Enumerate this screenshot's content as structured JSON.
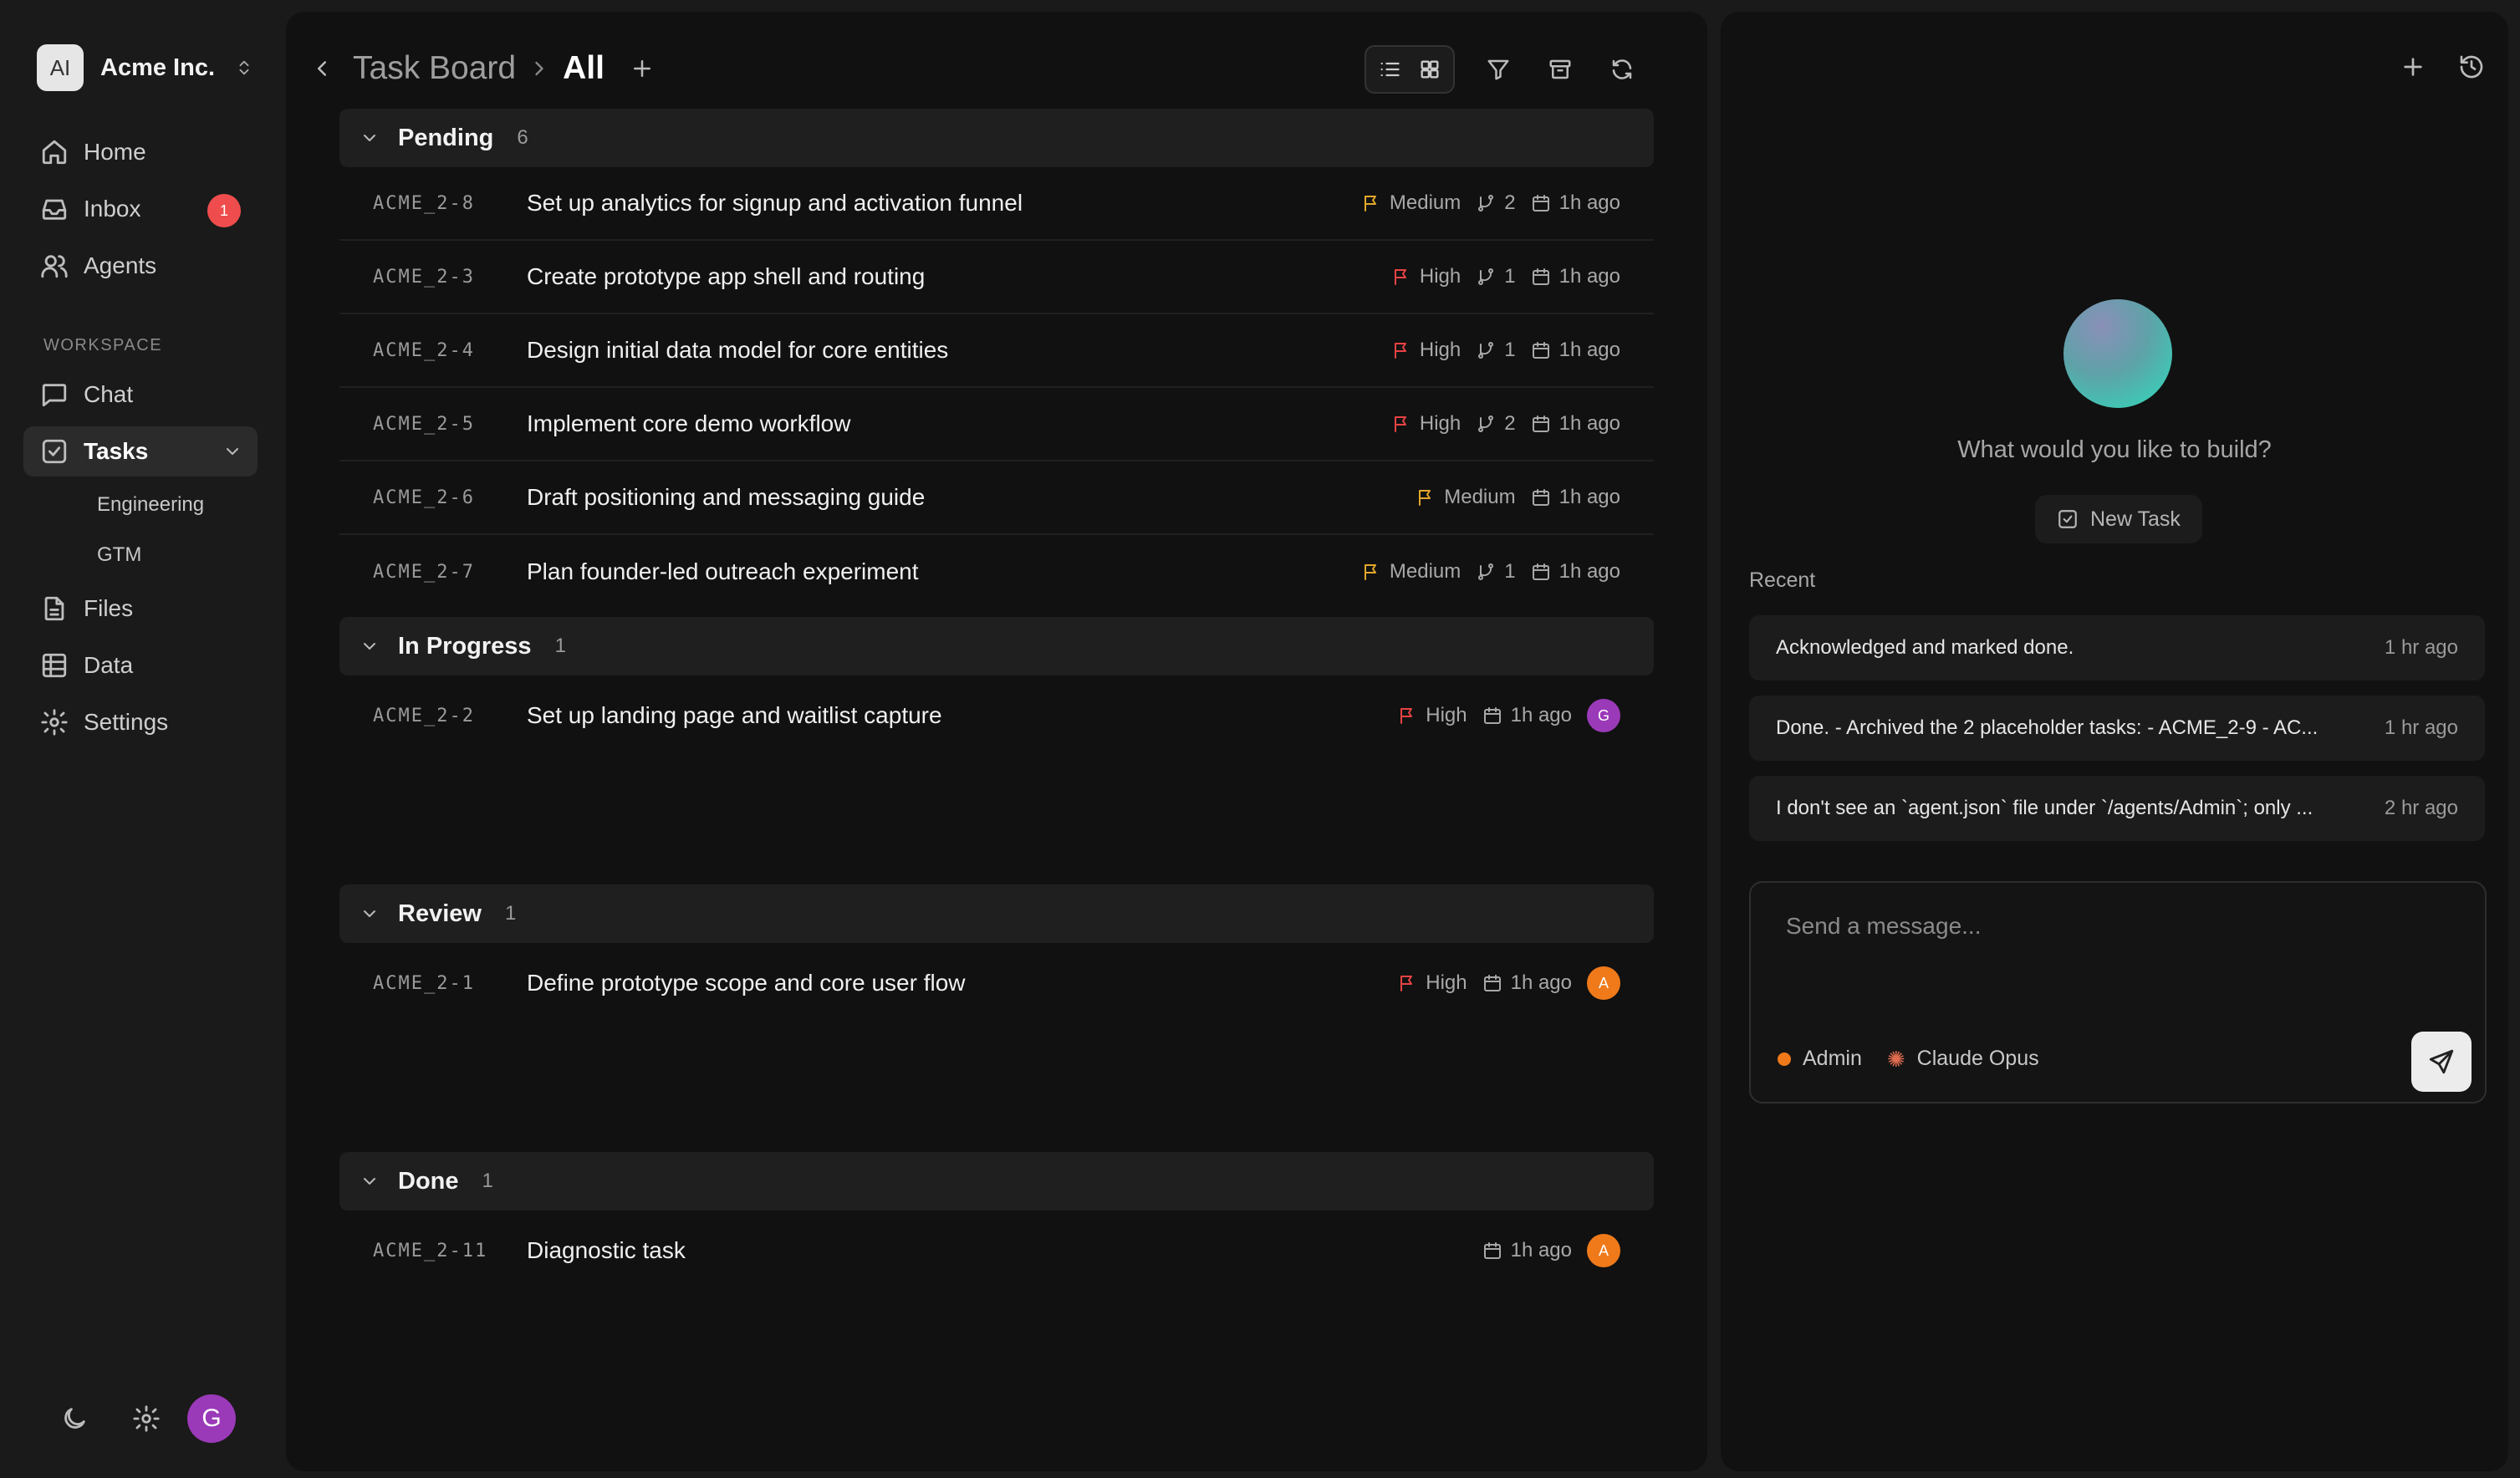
{
  "org": {
    "logo_text": "AI",
    "name": "Acme Inc."
  },
  "nav": {
    "home": "Home",
    "inbox": "Inbox",
    "inbox_badge": "1",
    "agents": "Agents",
    "workspace_label": "WORKSPACE",
    "chat": "Chat",
    "tasks": "Tasks",
    "sub_engineering": "Engineering",
    "sub_gtm": "GTM",
    "files": "Files",
    "data": "Data",
    "settings": "Settings"
  },
  "user": {
    "avatar_initial": "G",
    "avatar_color": "#9b3ab8"
  },
  "header": {
    "crumb_parent": "Task Board",
    "crumb_current": "All"
  },
  "groups": [
    {
      "name": "Pending",
      "count": "6",
      "tasks": [
        {
          "id": "ACME_2-8",
          "title": "Set up analytics for signup and activation funnel",
          "priority": "Medium",
          "subtasks": "2",
          "time": "1h ago"
        },
        {
          "id": "ACME_2-3",
          "title": "Create prototype app shell and routing",
          "priority": "High",
          "subtasks": "1",
          "time": "1h ago"
        },
        {
          "id": "ACME_2-4",
          "title": "Design initial data model for core entities",
          "priority": "High",
          "subtasks": "1",
          "time": "1h ago"
        },
        {
          "id": "ACME_2-5",
          "title": "Implement core demo workflow",
          "priority": "High",
          "subtasks": "2",
          "time": "1h ago"
        },
        {
          "id": "ACME_2-6",
          "title": "Draft positioning and messaging guide",
          "priority": "Medium",
          "time": "1h ago"
        },
        {
          "id": "ACME_2-7",
          "title": "Plan founder-led outreach experiment",
          "priority": "Medium",
          "subtasks": "1",
          "time": "1h ago"
        }
      ]
    },
    {
      "name": "In Progress",
      "count": "1",
      "tasks": [
        {
          "id": "ACME_2-2",
          "title": "Set up landing page and waitlist capture",
          "priority": "High",
          "time": "1h ago",
          "assignee": "G",
          "assignee_color": "#9b3ab8"
        }
      ]
    },
    {
      "name": "Review",
      "count": "1",
      "tasks": [
        {
          "id": "ACME_2-1",
          "title": "Define prototype scope and core user flow",
          "priority": "High",
          "time": "1h ago",
          "assignee": "A",
          "assignee_color": "#f07a1a"
        }
      ]
    },
    {
      "name": "Done",
      "count": "1",
      "tasks": [
        {
          "id": "ACME_2-11",
          "title": "Diagnostic task",
          "time": "1h ago",
          "assignee": "A",
          "assignee_color": "#f07a1a"
        }
      ]
    }
  ],
  "assistant": {
    "prompt": "What would you like to build?",
    "new_task": "New Task",
    "recent_label": "Recent",
    "recent": [
      {
        "text": "Acknowledged and marked done.",
        "time": "1 hr ago"
      },
      {
        "text": "Done. - Archived the 2 placeholder tasks: - ACME_2-9 - AC...",
        "time": "1 hr ago"
      },
      {
        "text": "I don't see an `agent.json` file under `/agents/Admin`; only ...",
        "time": "2 hr ago"
      }
    ],
    "composer_placeholder": "Send a message...",
    "agent_name": "Admin",
    "model_name": "Claude Opus"
  },
  "colors": {
    "priority_medium": "#e4a72b",
    "priority_high": "#e84343",
    "badge": "#ef4d4d"
  }
}
